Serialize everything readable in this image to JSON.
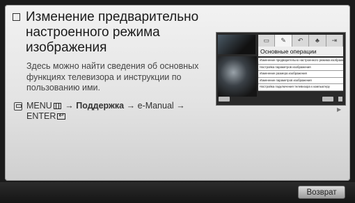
{
  "page": {
    "title": "Изменение предварительно настроенного режима изображения",
    "description": "Здесь можно найти сведения об основных функциях телевизора и инструкции по пользованию ими.",
    "path_menu": "MENU",
    "path_arrow1": "→",
    "path_support": "Поддержка",
    "path_arrow2": "→",
    "path_emanual": "e-Manual",
    "path_arrow3": "→",
    "path_enter": "ENTER"
  },
  "preview": {
    "heading": "Основные операции",
    "tabs": [
      "▭",
      "✎",
      "↶",
      "♣",
      "⇥"
    ],
    "items": [
      "Изменение предварительно настроенного режима изображения",
      "Настройка параметров изображения",
      "Изменение размера изображения",
      "Изменение параметров изображения",
      "Настройка подключения телевизора к компьютеру"
    ]
  },
  "footer": {
    "back_label": "Возврат"
  },
  "icons": {
    "title_bullet": "checkbox-icon",
    "remote": "remote-icon",
    "next": "play-right-icon"
  }
}
